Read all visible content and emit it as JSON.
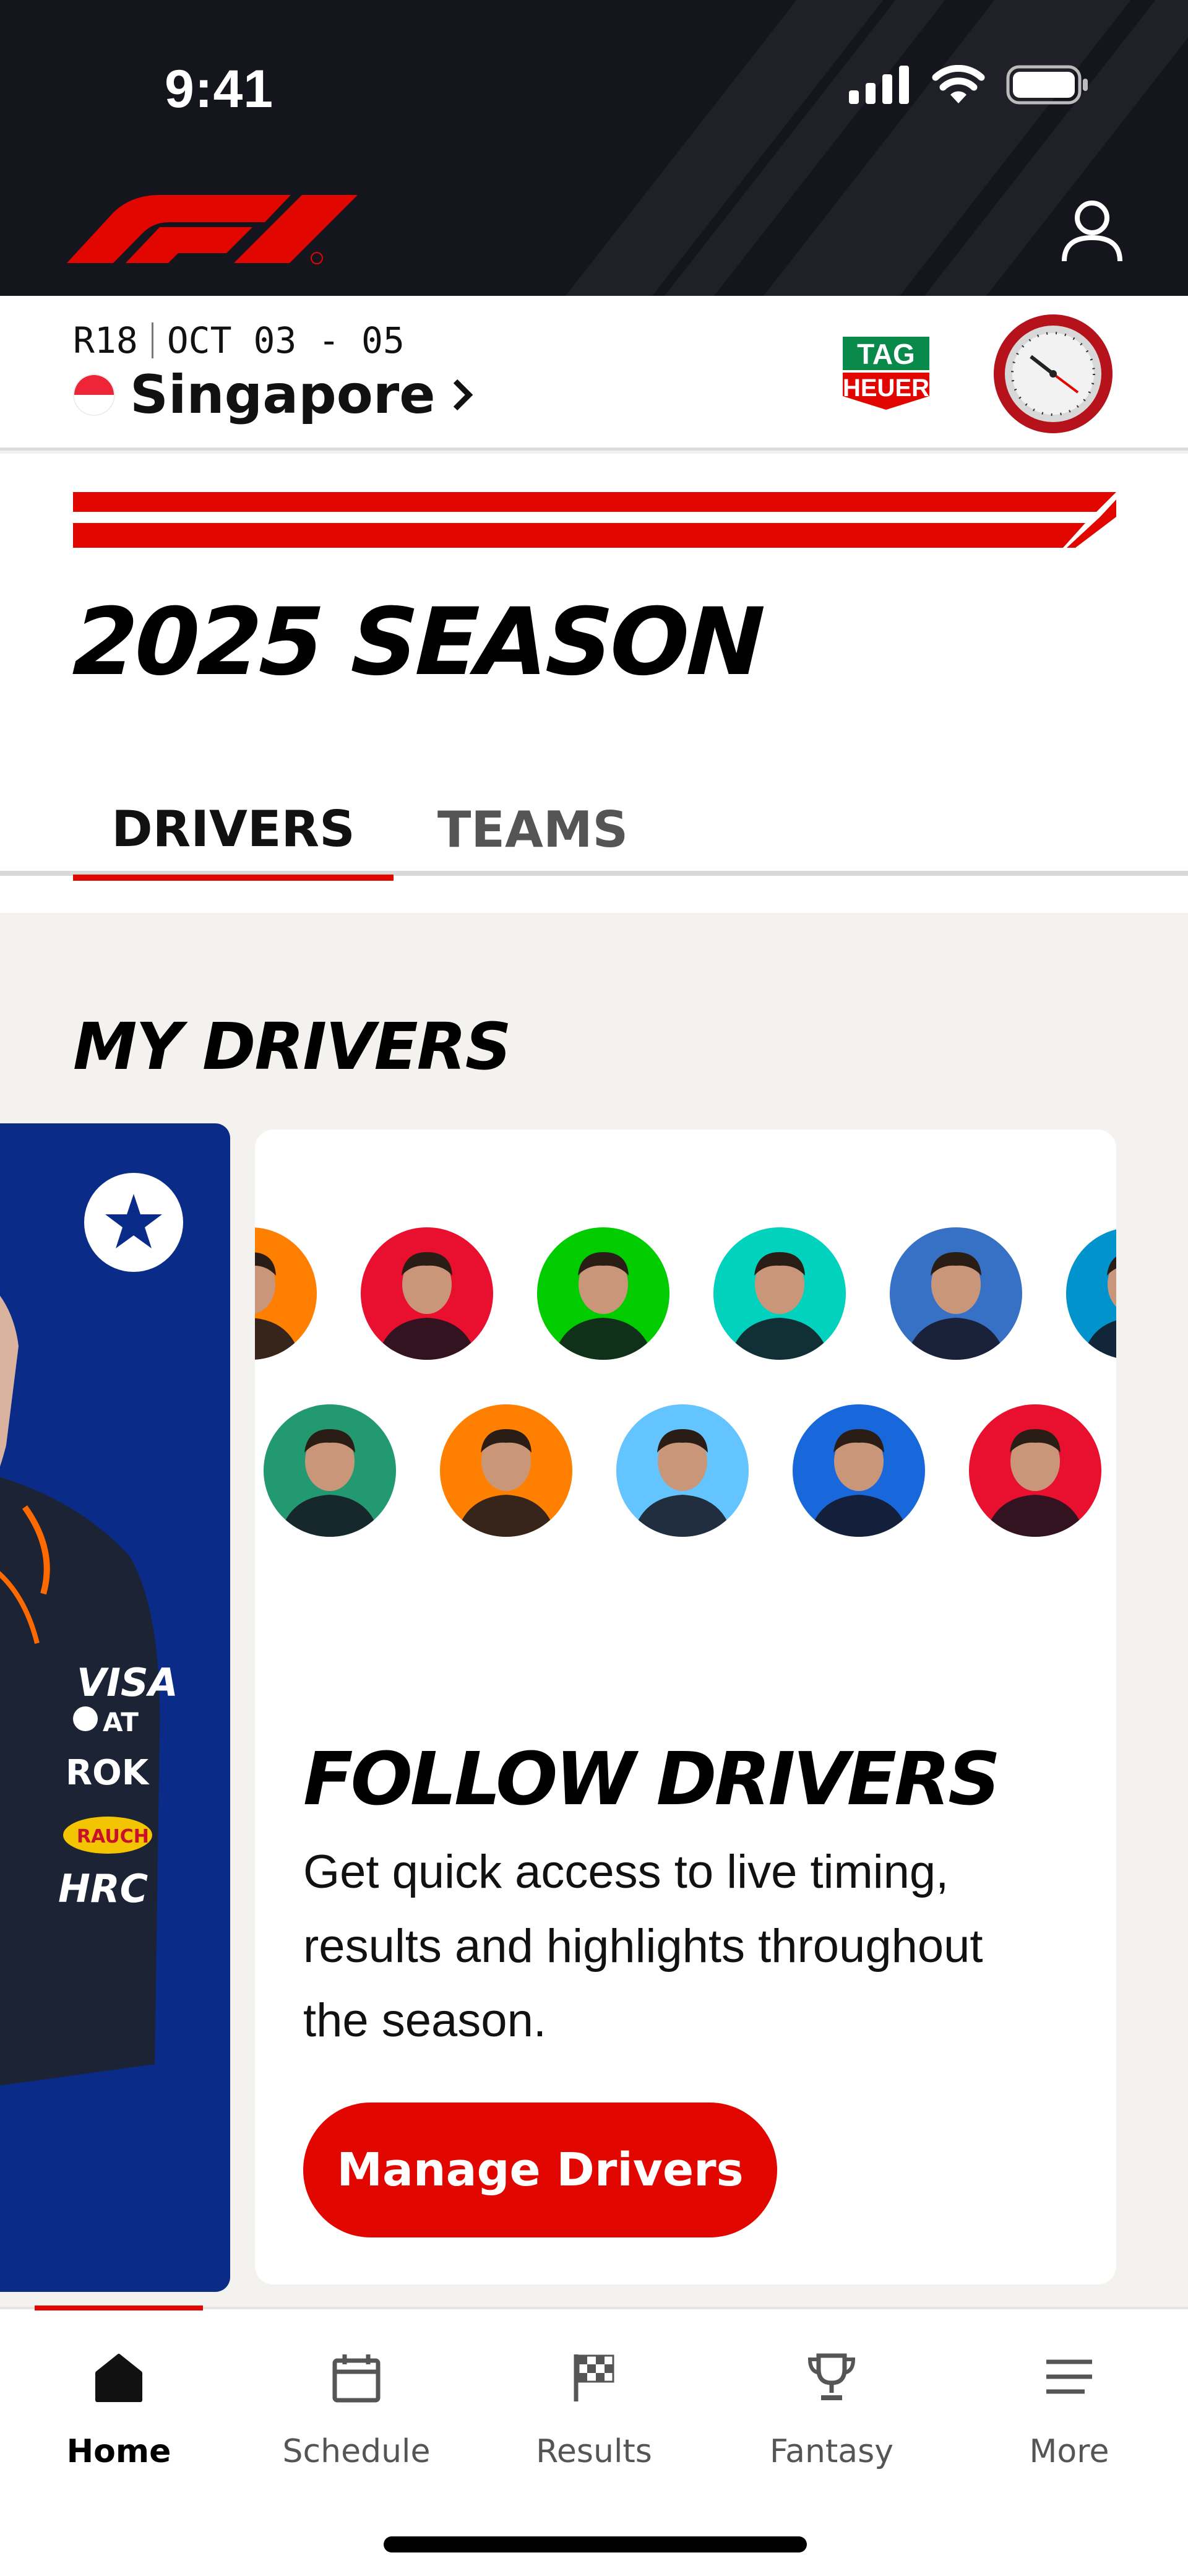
{
  "status_bar": {
    "time": "9:41"
  },
  "race": {
    "round": "R18",
    "dates": "OCT 03 - 05",
    "name": "Singapore"
  },
  "hero": {
    "title": "2025 SEASON",
    "tabs": [
      {
        "label": "DRIVERS",
        "active": true
      },
      {
        "label": "TEAMS",
        "active": false
      }
    ]
  },
  "my_drivers": {
    "title": "MY DRIVERS",
    "follow_title": "FOLLOW DRIVERS",
    "follow_description": "Get quick access to live timing, results and highlights throughout the season.",
    "manage_button": "Manage Drivers",
    "avatar_colors": {
      "row1": [
        "#ff8000",
        "#e8102e",
        "#00cc00",
        "#00d2be",
        "#3671c6",
        "#0093cc"
      ],
      "row2": [
        "#229971",
        "#ff8000",
        "#64c4ff",
        "#1868db",
        "#e8102e"
      ]
    }
  },
  "bottom_nav": [
    {
      "label": "Home",
      "icon": "home-icon",
      "active": true
    },
    {
      "label": "Schedule",
      "icon": "calendar-icon",
      "active": false
    },
    {
      "label": "Results",
      "icon": "checkered-flag-icon",
      "active": false
    },
    {
      "label": "Fantasy",
      "icon": "trophy-icon",
      "active": false
    },
    {
      "label": "More",
      "icon": "menu-icon",
      "active": false
    }
  ],
  "colors": {
    "accent": "#e10600",
    "header_bg": "#15151e",
    "driver_card_bg": "#0a2b87",
    "page_bg": "#f4f2ee"
  }
}
